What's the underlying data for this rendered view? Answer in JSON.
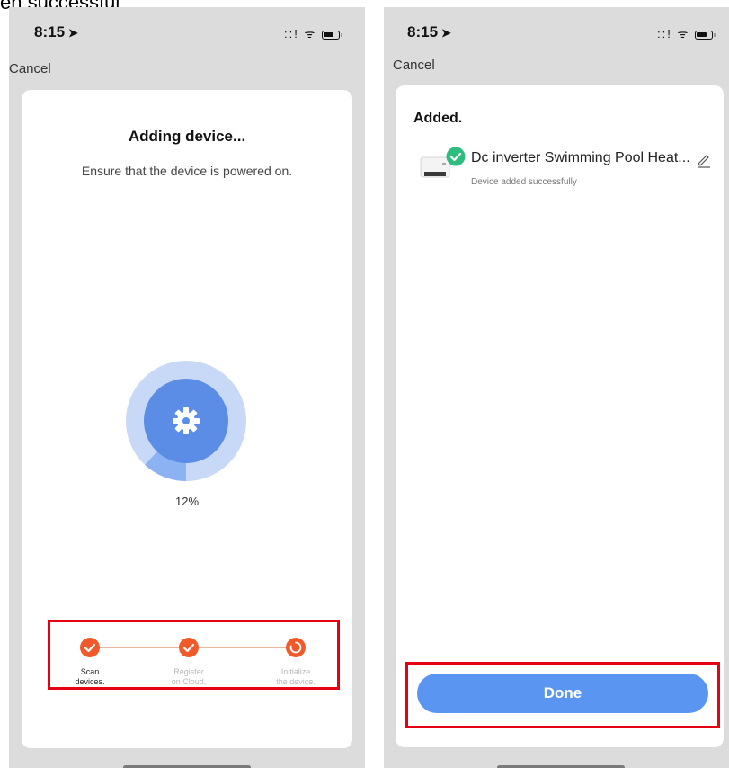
{
  "caption": "en successful",
  "left_screen": {
    "status_bar": {
      "time": "8:15",
      "signal": "::!",
      "wifi": "ᯤ"
    },
    "cancel_label": "Cancel",
    "title": "Adding device...",
    "subtitle": "Ensure that the device is powered on.",
    "progress": {
      "label": "12%",
      "fraction": 0.12
    },
    "steps": [
      {
        "label_line1": "Scan",
        "label_line2": "devices.",
        "state": "done"
      },
      {
        "label_line1": "Register",
        "label_line2": "on Cloud.",
        "state": "done"
      },
      {
        "label_line1": "Initialize",
        "label_line2": "the device.",
        "state": "in-progress"
      }
    ]
  },
  "right_screen": {
    "status_bar": {
      "time": "8:15",
      "signal": "::!",
      "wifi": "ᯤ"
    },
    "cancel_label": "Cancel",
    "heading": "Added.",
    "device": {
      "name": "Dc inverter Swimming Pool Heat...",
      "status": "Device added successfully"
    },
    "done_label": "Done"
  },
  "colors": {
    "accent_blue": "#5b95f2",
    "step_orange": "#f05a2a",
    "success_green": "#2dbd7e",
    "highlight_red": "#e60012"
  }
}
